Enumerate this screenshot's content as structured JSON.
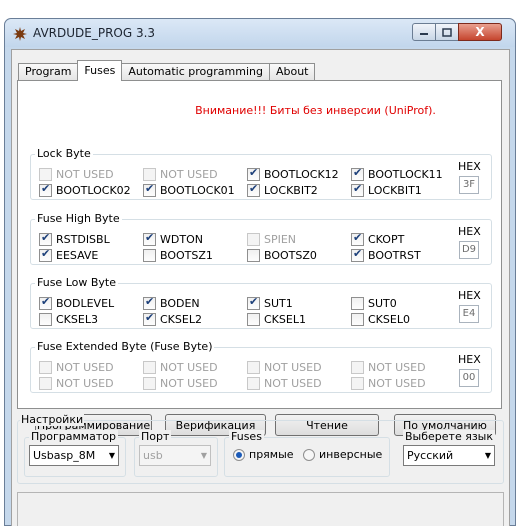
{
  "window": {
    "title": "AVRDUDE_PROG 3.3",
    "close_glyph": "X"
  },
  "tabs": [
    {
      "label": "Program",
      "active": false
    },
    {
      "label": "Fuses",
      "active": true
    },
    {
      "label": "Automatic programming",
      "active": false
    },
    {
      "label": "About",
      "active": false
    }
  ],
  "warning": "Внимание!!! Биты без инверсии (UniProf).",
  "hex_label": "HEX",
  "groups": [
    {
      "title": "Lock Byte",
      "hex": "3F",
      "rows": [
        [
          {
            "label": "NOT USED",
            "checked": false,
            "disabled": true
          },
          {
            "label": "NOT USED",
            "checked": false,
            "disabled": true
          },
          {
            "label": "BOOTLOCK12",
            "checked": true,
            "disabled": false
          },
          {
            "label": "BOOTLOCK11",
            "checked": true,
            "disabled": false
          }
        ],
        [
          {
            "label": "BOOTLOCK02",
            "checked": true,
            "disabled": false
          },
          {
            "label": "BOOTLOCK01",
            "checked": true,
            "disabled": false
          },
          {
            "label": "LOCKBIT2",
            "checked": true,
            "disabled": false
          },
          {
            "label": "LOCKBIT1",
            "checked": true,
            "disabled": false
          }
        ]
      ]
    },
    {
      "title": "Fuse High Byte",
      "hex": "D9",
      "rows": [
        [
          {
            "label": "RSTDISBL",
            "checked": true,
            "disabled": false
          },
          {
            "label": "WDTON",
            "checked": true,
            "disabled": false
          },
          {
            "label": "SPIEN",
            "checked": false,
            "disabled": true
          },
          {
            "label": "CKOPT",
            "checked": true,
            "disabled": false
          }
        ],
        [
          {
            "label": "EESAVE",
            "checked": true,
            "disabled": false
          },
          {
            "label": "BOOTSZ1",
            "checked": false,
            "disabled": false
          },
          {
            "label": "BOOTSZ0",
            "checked": false,
            "disabled": false
          },
          {
            "label": "BOOTRST",
            "checked": true,
            "disabled": false
          }
        ]
      ]
    },
    {
      "title": "Fuse Low Byte",
      "hex": "E4",
      "rows": [
        [
          {
            "label": "BODLEVEL",
            "checked": true,
            "disabled": false
          },
          {
            "label": "BODEN",
            "checked": true,
            "disabled": false
          },
          {
            "label": "SUT1",
            "checked": true,
            "disabled": false
          },
          {
            "label": "SUT0",
            "checked": false,
            "disabled": false
          }
        ],
        [
          {
            "label": "CKSEL3",
            "checked": false,
            "disabled": false
          },
          {
            "label": "CKSEL2",
            "checked": true,
            "disabled": false
          },
          {
            "label": "CKSEL1",
            "checked": false,
            "disabled": false
          },
          {
            "label": "CKSEL0",
            "checked": false,
            "disabled": false
          }
        ]
      ]
    },
    {
      "title": "Fuse Extended Byte (Fuse Byte)",
      "hex": "00",
      "rows": [
        [
          {
            "label": "NOT USED",
            "checked": false,
            "disabled": true
          },
          {
            "label": "NOT USED",
            "checked": false,
            "disabled": true
          },
          {
            "label": "NOT USED",
            "checked": false,
            "disabled": true
          },
          {
            "label": "NOT USED",
            "checked": false,
            "disabled": true
          }
        ],
        [
          {
            "label": "NOT USED",
            "checked": false,
            "disabled": true
          },
          {
            "label": "NOT USED",
            "checked": false,
            "disabled": true
          },
          {
            "label": "NOT USED",
            "checked": false,
            "disabled": true
          },
          {
            "label": "NOT USED",
            "checked": false,
            "disabled": true
          }
        ]
      ]
    }
  ],
  "buttons": {
    "program": "Программирование",
    "verify": "Верификация",
    "read": "Чтение",
    "default": "По умолчанию"
  },
  "settings": {
    "title": "Настройки",
    "programmer_label": "Программатор",
    "programmer_value": "Usbasp_8M",
    "port_label": "Порт",
    "port_value": "usb",
    "fuses_label": "Fuses",
    "radio_direct": "прямые",
    "radio_inverse": "инверсные",
    "radio_selected": "direct",
    "language_label": "Выберете язык",
    "language_value": "Русский"
  }
}
